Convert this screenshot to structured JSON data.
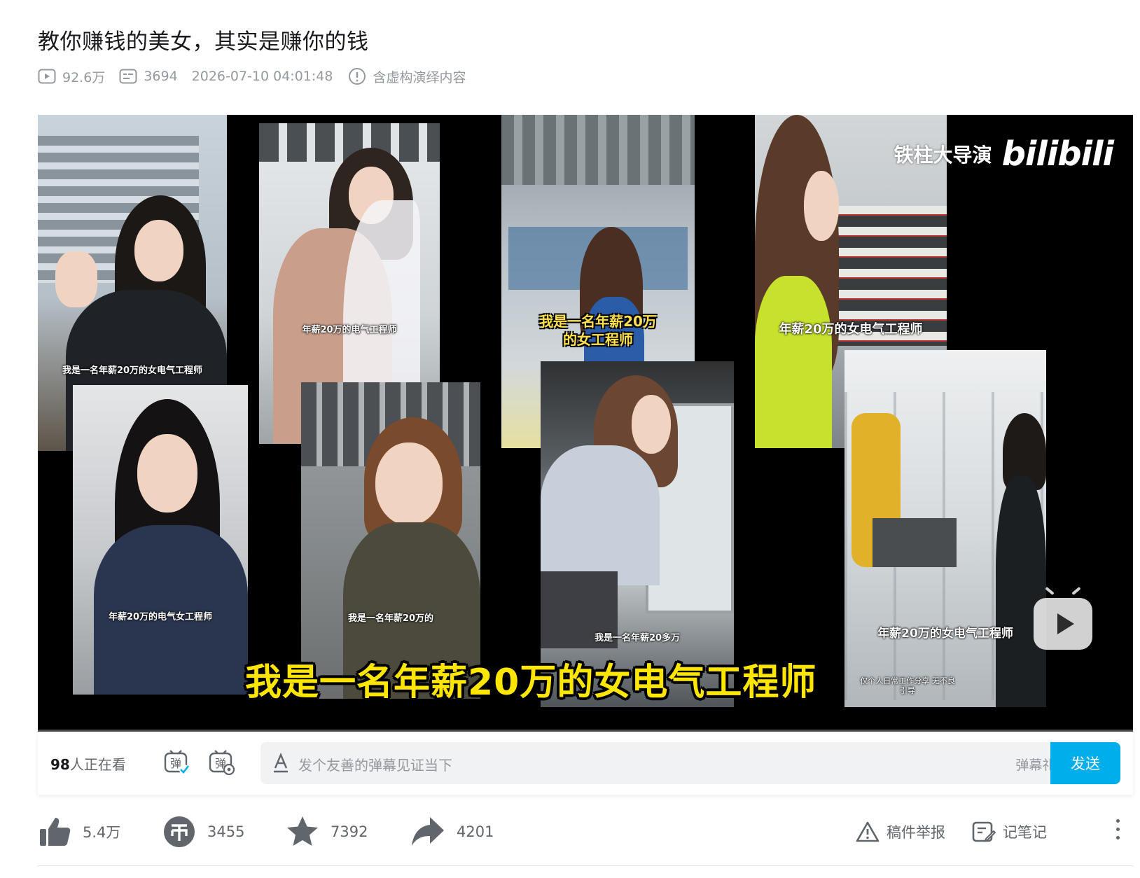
{
  "video": {
    "title": "教你赚钱的美女，其实是赚你的钱",
    "views": "92.6万",
    "danmaku_count": "3694",
    "publish_time": "2026-07-10 04:01:48",
    "notice": "含虚构演绎内容"
  },
  "player": {
    "watermark_uploader": "铁柱大导演",
    "watermark_logo": "bilibili",
    "main_subtitle": "我是一名年薪20万的女电气工程师",
    "panels": [
      {
        "caption": "我是一名年薪20万的女电气工程师"
      },
      {
        "caption": "年薪20万的电气工程师"
      },
      {
        "caption": "我是一名年薪20万\n的女工程师"
      },
      {
        "caption": "年薪20万的女电气工程师"
      },
      {
        "caption": "年薪20万的电气女工程师"
      },
      {
        "caption": "我是一名年薪20万的"
      },
      {
        "caption": "我是一名年薪20多万"
      },
      {
        "caption": "年薪20万的女电气工程师"
      },
      {
        "caption": "仅个人日常工作分享 无不良引导"
      }
    ]
  },
  "danmaku": {
    "viewers_count": "98",
    "viewers_suffix": "人正在看",
    "placeholder": "发个友善的弹幕见证当下",
    "etiquette_label": "弹幕礼仪 ›",
    "send_label": "发送"
  },
  "actions": {
    "like": "5.4万",
    "coin": "3455",
    "favorite": "7392",
    "share": "4201",
    "report_label": "稿件举报",
    "notes_label": "记笔记"
  },
  "colors": {
    "accent": "#00aeec",
    "text_secondary": "#9499a0",
    "subtitle_yellow": "#ffe600"
  }
}
